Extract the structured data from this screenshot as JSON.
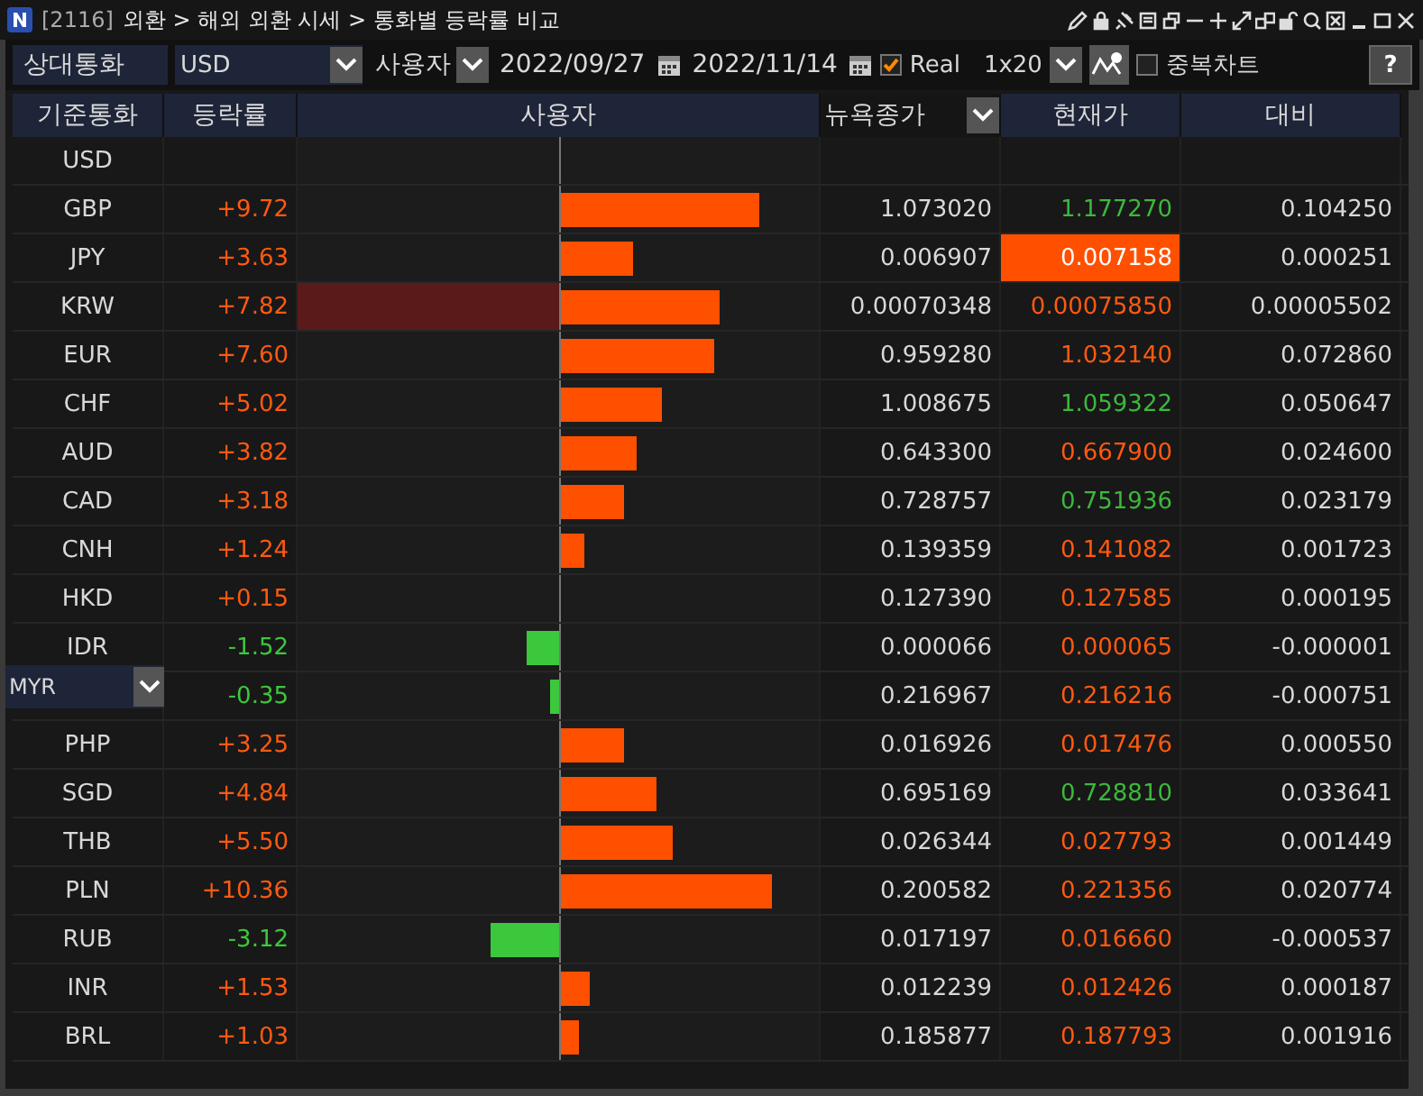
{
  "window": {
    "code": "[2116]",
    "title": "외환 > 해외 외환 시세 > 통화별 등락률 비교"
  },
  "toolbar": {
    "label": "상대통화",
    "currency": "USD",
    "mode": "사용자",
    "start_date": "2022/09/27",
    "end_date": "2022/11/14",
    "real": {
      "label": "Real",
      "checked": true
    },
    "scale": "1x20",
    "overlap": {
      "label": "중복차트",
      "checked": false
    },
    "help": "?"
  },
  "table": {
    "columns": [
      "기준통화",
      "등락률",
      "사용자",
      "뉴욕종가",
      "현재가",
      "대비"
    ],
    "rows": [
      {
        "name": "USD",
        "selected": false,
        "flash": false
      },
      {
        "name": "GBP",
        "rate": "+9.72",
        "kind": "up",
        "level": 0.77,
        "close": "1.073020",
        "price": "1.177270",
        "color": "#3cb83c",
        "diff": "0.104250",
        "selected": false,
        "flash": false
      },
      {
        "name": "JPY",
        "rate": "+3.63",
        "kind": "up",
        "level": 0.29,
        "close": "0.006907",
        "price": "0.007158",
        "color": "#ffffff",
        "diff": "0.000251",
        "selected": false,
        "flash": true
      },
      {
        "name": "KRW",
        "rate": "+7.82",
        "kind": "up",
        "level": 0.62,
        "close": "0.00070348",
        "price": "0.00075850",
        "color": "#ff5a10",
        "diff": "0.00005502",
        "selected": true,
        "flash": false
      },
      {
        "name": "EUR",
        "rate": "+7.60",
        "kind": "up",
        "level": 0.6,
        "close": "0.959280",
        "price": "1.032140",
        "color": "#ff5a10",
        "diff": "0.072860",
        "selected": false,
        "flash": false
      },
      {
        "name": "CHF",
        "rate": "+5.02",
        "kind": "up",
        "level": 0.4,
        "close": "1.008675",
        "price": "1.059322",
        "color": "#3cb83c",
        "diff": "0.050647",
        "selected": false,
        "flash": false
      },
      {
        "name": "AUD",
        "rate": "+3.82",
        "kind": "up",
        "level": 0.3,
        "close": "0.643300",
        "price": "0.667900",
        "color": "#ff5a10",
        "diff": "0.024600",
        "selected": false,
        "flash": false
      },
      {
        "name": "CAD",
        "rate": "+3.18",
        "kind": "up",
        "level": 0.25,
        "close": "0.728757",
        "price": "0.751936",
        "color": "#3cb83c",
        "diff": "0.023179",
        "selected": false,
        "flash": false
      },
      {
        "name": "CNH",
        "rate": "+1.24",
        "kind": "up",
        "level": 0.1,
        "close": "0.139359",
        "price": "0.141082",
        "color": "#ff5a10",
        "diff": "0.001723",
        "selected": false,
        "flash": false
      },
      {
        "name": "HKD",
        "rate": "+0.15",
        "kind": "up",
        "level": 0.01,
        "close": "0.127390",
        "price": "0.127585",
        "color": "#ff5a10",
        "diff": "0.000195",
        "selected": false,
        "flash": false
      },
      {
        "name": "IDR",
        "rate": "-1.52",
        "kind": "down",
        "level": 0.12,
        "close": "0.000066",
        "price": "0.000065",
        "color": "#ff5a10",
        "diff": "-0.000001",
        "selected": false,
        "flash": false
      },
      {
        "editor": {
          "value": "MYR"
        },
        "rate": "-0.35",
        "kind": "down",
        "level": 0.03,
        "close": "0.216967",
        "price": "0.216216",
        "color": "#ff5a10",
        "diff": "-0.000751",
        "selected": false,
        "flash": false
      },
      {
        "name": "PHP",
        "rate": "+3.25",
        "kind": "up",
        "level": 0.25,
        "close": "0.016926",
        "price": "0.017476",
        "color": "#ff5a10",
        "diff": "0.000550",
        "selected": false,
        "flash": false
      },
      {
        "name": "SGD",
        "rate": "+4.84",
        "kind": "up",
        "level": 0.38,
        "close": "0.695169",
        "price": "0.728810",
        "color": "#3cb83c",
        "diff": "0.033641",
        "selected": false,
        "flash": false
      },
      {
        "name": "THB",
        "rate": "+5.50",
        "kind": "up",
        "level": 0.44,
        "close": "0.026344",
        "price": "0.027793",
        "color": "#ff5a10",
        "diff": "0.001449",
        "selected": false,
        "flash": false
      },
      {
        "name": "PLN",
        "rate": "+10.36",
        "kind": "up",
        "level": 0.82,
        "close": "0.200582",
        "price": "0.221356",
        "color": "#ff5a10",
        "diff": "0.020774",
        "selected": false,
        "flash": false
      },
      {
        "name": "RUB",
        "rate": "-3.12",
        "kind": "down",
        "level": 0.26,
        "close": "0.017197",
        "price": "0.016660",
        "color": "#ff5a10",
        "diff": "-0.000537",
        "selected": false,
        "flash": false
      },
      {
        "name": "INR",
        "rate": "+1.53",
        "kind": "up",
        "level": 0.12,
        "close": "0.012239",
        "price": "0.012426",
        "color": "#ff5a10",
        "diff": "0.000187",
        "selected": false,
        "flash": false
      },
      {
        "name": "BRL",
        "rate": "+1.03",
        "kind": "up",
        "level": 0.08,
        "close": "0.185877",
        "price": "0.187793",
        "color": "#ff5a10",
        "diff": "0.001916",
        "selected": false,
        "flash": false
      }
    ]
  }
}
